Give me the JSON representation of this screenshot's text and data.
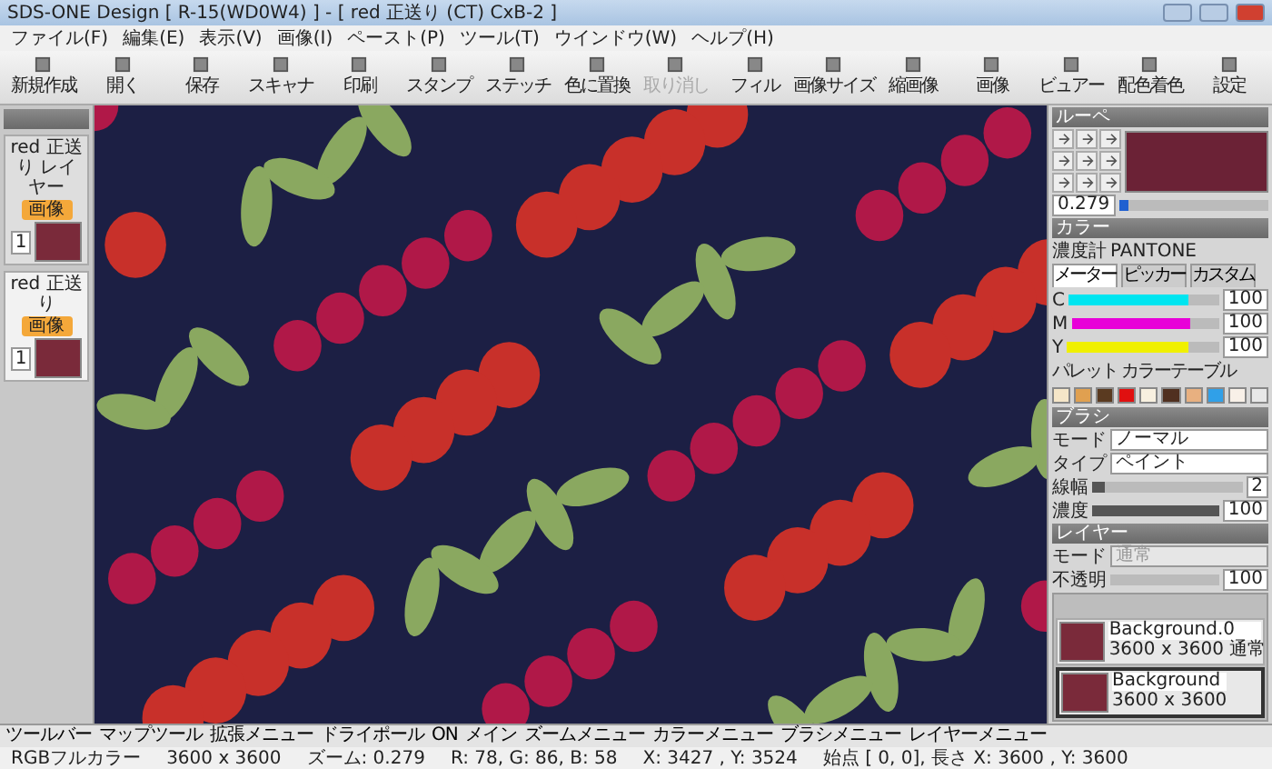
{
  "window": {
    "title": "SDS-ONE Design [ R-15(WD0W4) ] - [ red 正送り (CT) CxB-2 ]"
  },
  "menu": [
    "ファイル(F)",
    "編集(E)",
    "表示(V)",
    "画像(I)",
    "ペースト(P)",
    "ツール(T)",
    "ウインドウ(W)",
    "ヘルプ(H)"
  ],
  "toolbar": [
    {
      "label": "新規作成",
      "disabled": false
    },
    {
      "label": "開く",
      "disabled": false
    },
    {
      "label": "保存",
      "disabled": false
    },
    {
      "label": "スキャナ",
      "disabled": false
    },
    {
      "label": "印刷",
      "disabled": false
    },
    {
      "label": "スタンプ",
      "disabled": false
    },
    {
      "label": "ステッチ",
      "disabled": false
    },
    {
      "label": "色に置換",
      "disabled": false
    },
    {
      "label": "取り消し",
      "disabled": true
    },
    {
      "label": "フィル",
      "disabled": false
    },
    {
      "label": "画像サイズ",
      "disabled": false
    },
    {
      "label": "縮画像",
      "disabled": false
    },
    {
      "label": "画像",
      "disabled": false
    },
    {
      "label": "ビュアー",
      "disabled": false
    },
    {
      "label": "配色着色",
      "disabled": false
    },
    {
      "label": "設定",
      "disabled": false
    }
  ],
  "documents": [
    {
      "name": "red 正送り レイヤー",
      "badge": "画像",
      "page": "1",
      "selected": false
    },
    {
      "name": "red 正送り",
      "badge": "画像",
      "page": "1",
      "selected": true
    }
  ],
  "loupe": {
    "title": "ルーペ",
    "zoom": "0.279",
    "level": 0.06
  },
  "color": {
    "title": "カラー",
    "densitometer": "濃度計",
    "library": "PANTONE",
    "tabs": [
      {
        "label": "メーター",
        "selected": true
      },
      {
        "label": "ピッカー",
        "selected": false
      },
      {
        "label": "カスタム",
        "selected": false
      }
    ],
    "channels": [
      {
        "name": "C",
        "value": "100",
        "level": 0.8,
        "color": "#00e5f0"
      },
      {
        "name": "M",
        "value": "100",
        "level": 0.8,
        "color": "#e800d8"
      },
      {
        "name": "Y",
        "value": "100",
        "level": 0.8,
        "color": "#f0f000"
      }
    ],
    "palette_label": "パレット",
    "table_label": "カラーテーブル",
    "swatches": [
      {
        "color": "#f5e6c8"
      },
      {
        "color": "#e0a050"
      },
      {
        "color": "#5a3a20"
      },
      {
        "color": "#e01010"
      },
      {
        "color": "#f8f0e0"
      },
      {
        "color": "#503020"
      },
      {
        "color": "#e8b080"
      },
      {
        "color": "#30a0e8"
      },
      {
        "color": "#f8f0e8"
      },
      {
        "color": "#e8e8e8"
      }
    ]
  },
  "brush": {
    "title": "ブラシ",
    "fields": [
      {
        "kind": "select",
        "label": "モード",
        "value": "ノーマル"
      },
      {
        "kind": "select",
        "label": "タイプ",
        "value": "ペイント"
      },
      {
        "kind": "slider",
        "label": "線幅",
        "value": "2",
        "level": 0.08
      },
      {
        "kind": "slider",
        "label": "濃度",
        "value": "100",
        "level": 1
      }
    ]
  },
  "layers": {
    "title": "レイヤー",
    "mode_label": "モード",
    "mode": "通常",
    "opacity_label": "不透明",
    "opacity": "100",
    "items": [
      {
        "name": "Background.0",
        "size": "3600 x 3600",
        "blend": "通常",
        "selected": false
      },
      {
        "name": "Background",
        "size": "3600 x 3600",
        "selected": true
      }
    ]
  },
  "bottom_toolbar": [
    "ツールバー",
    "マップツール",
    "拡張メニュー",
    "ドライポール",
    "ON",
    "メイン",
    "ズームメニュー",
    "カラーメニュー",
    "ブラシメニュー",
    "レイヤーメニュー"
  ],
  "status_bar": [
    "RGBフルカラー",
    "3600 x 3600",
    "ズーム: 0.279",
    "R: 78, G: 86, B: 58",
    "X: 3427 , Y: 3524",
    "始点 [ 0, 0], 長さ X: 3600 , Y: 3600"
  ]
}
